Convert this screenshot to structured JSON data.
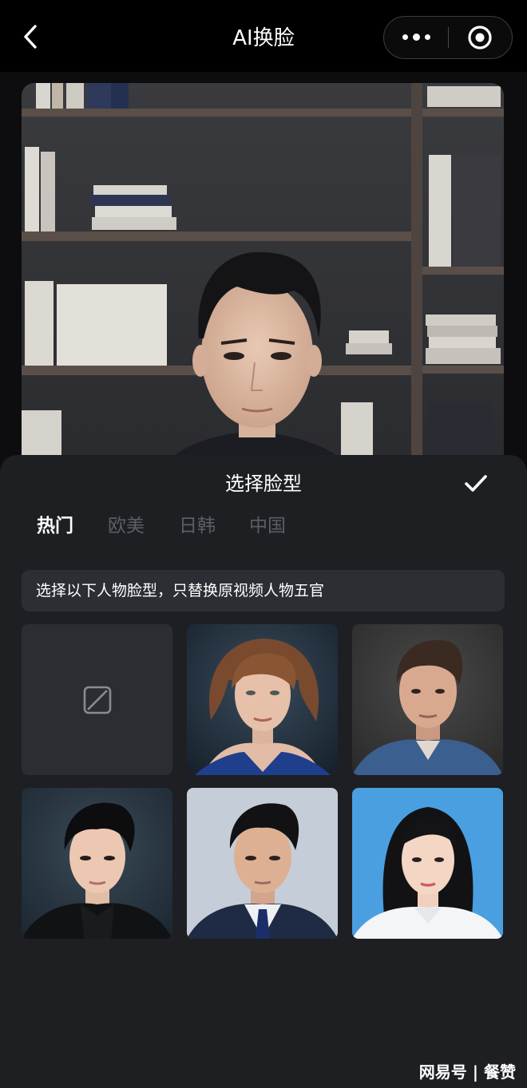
{
  "navbar": {
    "title": "AI换脸",
    "back_icon": "chevron-left-icon",
    "more_icon": "more-dots-icon",
    "close_icon": "target-close-icon"
  },
  "sheet": {
    "title": "选择脸型",
    "confirm_icon": "checkmark-icon",
    "tabs": [
      {
        "label": "热门",
        "active": true
      },
      {
        "label": "欧美",
        "active": false
      },
      {
        "label": "日韩",
        "active": false
      },
      {
        "label": "中国",
        "active": false
      }
    ],
    "tip": "选择以下人物脸型，只替换原视频人物五官",
    "faces": [
      {
        "kind": "none",
        "icon": "slash-square-icon"
      },
      {
        "kind": "face",
        "desc": "western-woman-portrait"
      },
      {
        "kind": "face",
        "desc": "western-man-portrait"
      },
      {
        "kind": "face",
        "desc": "asian-young-man-portrait"
      },
      {
        "kind": "face",
        "desc": "asian-man-suit-portrait"
      },
      {
        "kind": "face",
        "desc": "asian-woman-portrait"
      }
    ]
  },
  "watermark": "网易号 | 餐赞",
  "colors": {
    "background": "#0d0d0f",
    "sheet": "#1e1f23",
    "tip_bg": "#2d2e33",
    "tab_inactive": "#5d5e63"
  }
}
